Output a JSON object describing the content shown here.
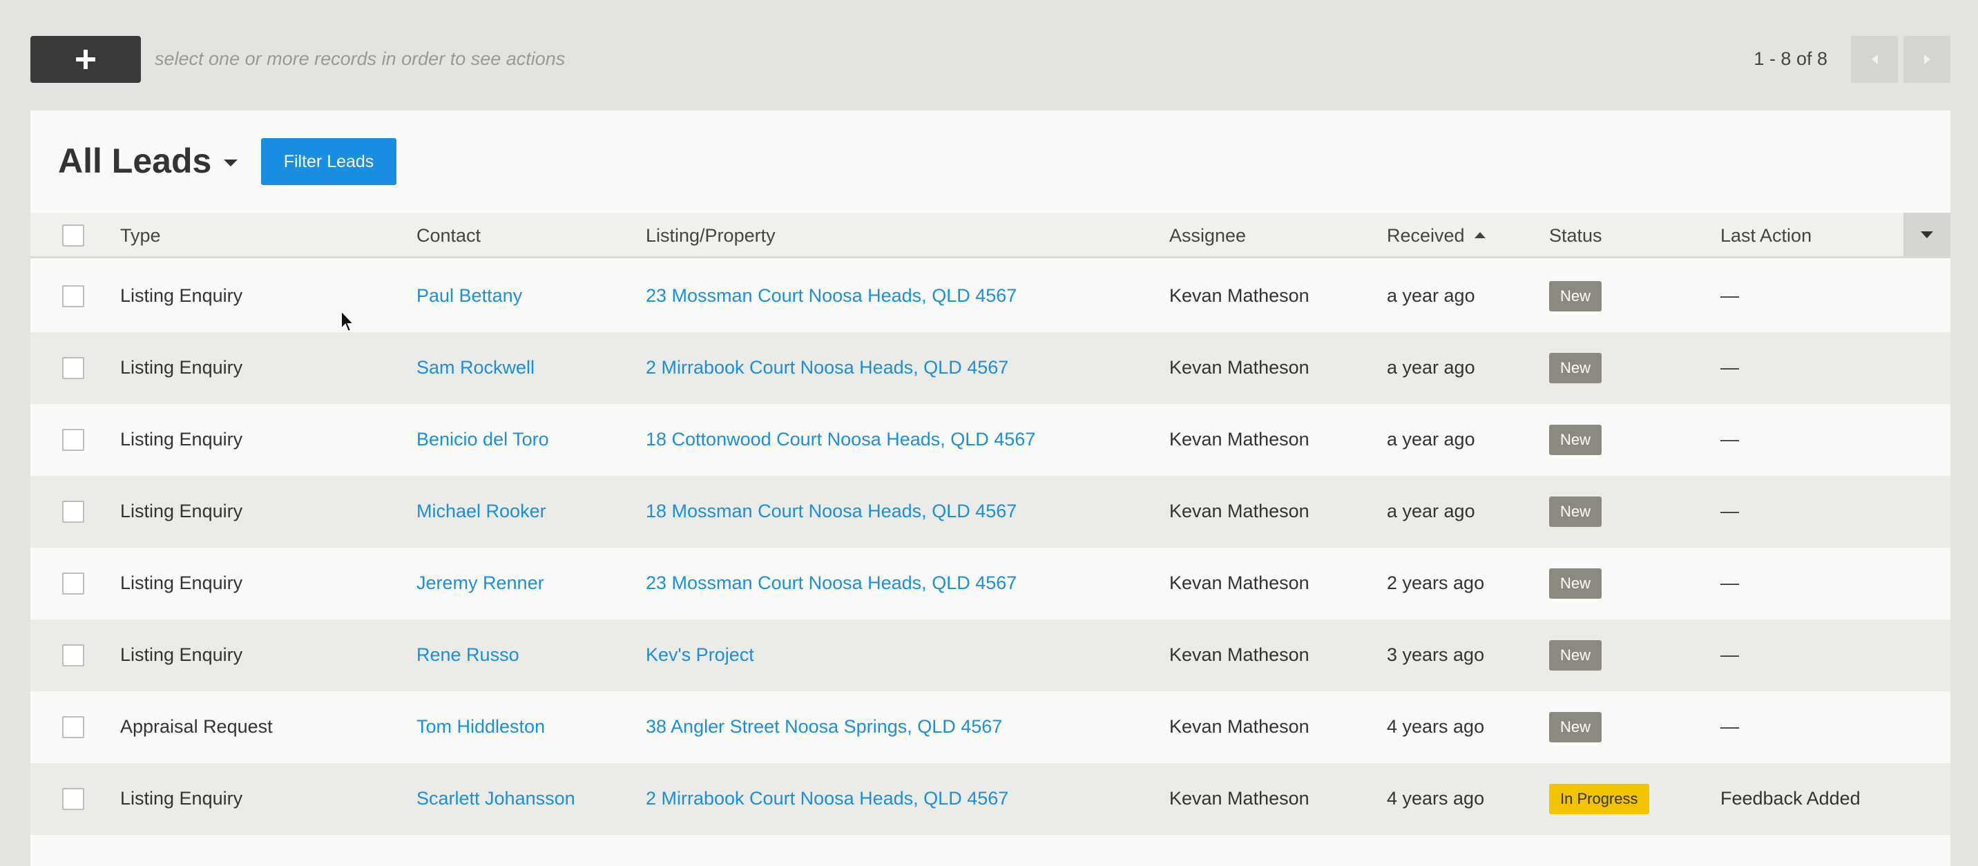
{
  "toolbar": {
    "hint": "select one or more records in order to see actions",
    "pagination": "1 - 8 of 8"
  },
  "header": {
    "title": "All Leads",
    "filter_label": "Filter Leads"
  },
  "columns": {
    "type": "Type",
    "contact": "Contact",
    "listing": "Listing/Property",
    "assignee": "Assignee",
    "received": "Received",
    "status": "Status",
    "last_action": "Last Action"
  },
  "rows": [
    {
      "type": "Listing Enquiry",
      "contact": "Paul Bettany",
      "listing": "23 Mossman Court Noosa Heads, QLD 4567",
      "assignee": "Kevan Matheson",
      "received": "a year ago",
      "status": "New",
      "last_action": "—"
    },
    {
      "type": "Listing Enquiry",
      "contact": "Sam Rockwell",
      "listing": "2 Mirrabook Court Noosa Heads, QLD 4567",
      "assignee": "Kevan Matheson",
      "received": "a year ago",
      "status": "New",
      "last_action": "—"
    },
    {
      "type": "Listing Enquiry",
      "contact": "Benicio del Toro",
      "listing": "18 Cottonwood Court Noosa Heads, QLD 4567",
      "assignee": "Kevan Matheson",
      "received": "a year ago",
      "status": "New",
      "last_action": "—"
    },
    {
      "type": "Listing Enquiry",
      "contact": "Michael Rooker",
      "listing": "18 Mossman Court Noosa Heads, QLD 4567",
      "assignee": "Kevan Matheson",
      "received": "a year ago",
      "status": "New",
      "last_action": "—"
    },
    {
      "type": "Listing Enquiry",
      "contact": "Jeremy Renner",
      "listing": "23 Mossman Court Noosa Heads, QLD 4567",
      "assignee": "Kevan Matheson",
      "received": "2 years ago",
      "status": "New",
      "last_action": "—"
    },
    {
      "type": "Listing Enquiry",
      "contact": "Rene Russo",
      "listing": "Kev's Project",
      "assignee": "Kevan Matheson",
      "received": "3 years ago",
      "status": "New",
      "last_action": "—"
    },
    {
      "type": "Appraisal Request",
      "contact": "Tom Hiddleston",
      "listing": "38 Angler Street Noosa Springs, QLD 4567",
      "assignee": "Kevan Matheson",
      "received": "4 years ago",
      "status": "New",
      "last_action": "—"
    },
    {
      "type": "Listing Enquiry",
      "contact": "Scarlett Johansson",
      "listing": "2 Mirrabook Court Noosa Heads, QLD 4567",
      "assignee": "Kevan Matheson",
      "received": "4 years ago",
      "status": "In Progress",
      "last_action": "Feedback Added"
    }
  ],
  "colors": {
    "accent": "#1a8ee0",
    "badge_new": "#8c8a80",
    "badge_progress": "#f2c400"
  }
}
